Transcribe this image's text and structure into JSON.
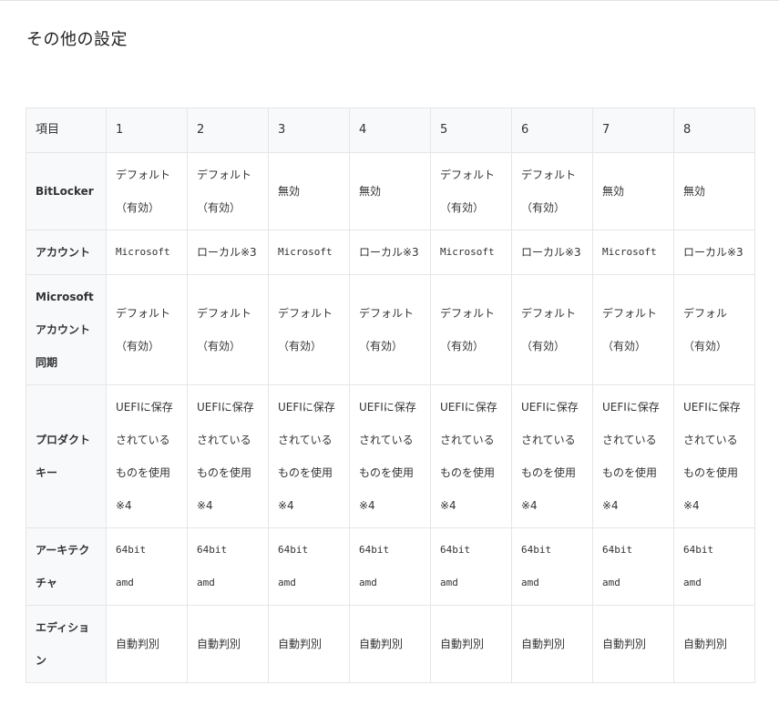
{
  "section": {
    "title": "その他の設定"
  },
  "table": {
    "header_label": "項目",
    "columns": [
      "1",
      "2",
      "3",
      "4",
      "5",
      "6",
      "7",
      "8"
    ],
    "rows": [
      {
        "label": "BitLocker",
        "cells": [
          [
            "デフォルト",
            "（有効）"
          ],
          [
            "デフォルト",
            "（有効）"
          ],
          [
            "無効"
          ],
          [
            "無効"
          ],
          [
            "デフォルト",
            "（有効）"
          ],
          [
            "デフォルト",
            "（有効）"
          ],
          [
            "無効"
          ],
          [
            "無効"
          ]
        ]
      },
      {
        "label": "アカウント",
        "cells": [
          [
            "Microsoft"
          ],
          [
            "ローカル※3"
          ],
          [
            "Microsoft"
          ],
          [
            "ローカル※3"
          ],
          [
            "Microsoft"
          ],
          [
            "ローカル※3"
          ],
          [
            "Microsoft"
          ],
          [
            "ローカル※3"
          ]
        ]
      },
      {
        "label": "Microsoftアカウント同期",
        "cells": [
          [
            "デフォルト",
            "（有効）"
          ],
          [
            "デフォルト",
            "（有効）"
          ],
          [
            "デフォルト",
            "（有効）"
          ],
          [
            "デフォルト",
            "（有効）"
          ],
          [
            "デフォルト",
            "（有効）"
          ],
          [
            "デフォルト",
            "（有効）"
          ],
          [
            "デフォルト",
            "（有効）"
          ],
          [
            "デフォル",
            "（有効）"
          ]
        ]
      },
      {
        "label": "プロダクトキー",
        "cells": [
          [
            "UEFIに保存",
            "されている",
            "ものを使用",
            "※4"
          ],
          [
            "UEFIに保存",
            "されている",
            "ものを使用",
            "※4"
          ],
          [
            "UEFIに保存",
            "されている",
            "ものを使用",
            "※4"
          ],
          [
            "UEFIに保存",
            "されている",
            "ものを使用",
            "※4"
          ],
          [
            "UEFIに保存",
            "されている",
            "ものを使用",
            "※4"
          ],
          [
            "UEFIに保存",
            "されている",
            "ものを使用",
            "※4"
          ],
          [
            "UEFIに保存",
            "されている",
            "ものを使用",
            "※4"
          ],
          [
            "UEFIに保存",
            "されている",
            "ものを使用",
            "※4"
          ]
        ]
      },
      {
        "label": "アーキテクチャ",
        "cells": [
          [
            "64bit",
            "amd"
          ],
          [
            "64bit",
            "amd"
          ],
          [
            "64bit",
            "amd"
          ],
          [
            "64bit",
            "amd"
          ],
          [
            "64bit",
            "amd"
          ],
          [
            "64bit",
            "amd"
          ],
          [
            "64bit",
            "amd"
          ],
          [
            "64bit",
            "amd"
          ]
        ]
      },
      {
        "label": "エディション",
        "cells": [
          [
            "自動判別"
          ],
          [
            "自動判別"
          ],
          [
            "自動判別"
          ],
          [
            "自動判別"
          ],
          [
            "自動判別"
          ],
          [
            "自動判別"
          ],
          [
            "自動判別"
          ],
          [
            "自動判別"
          ]
        ]
      }
    ]
  }
}
